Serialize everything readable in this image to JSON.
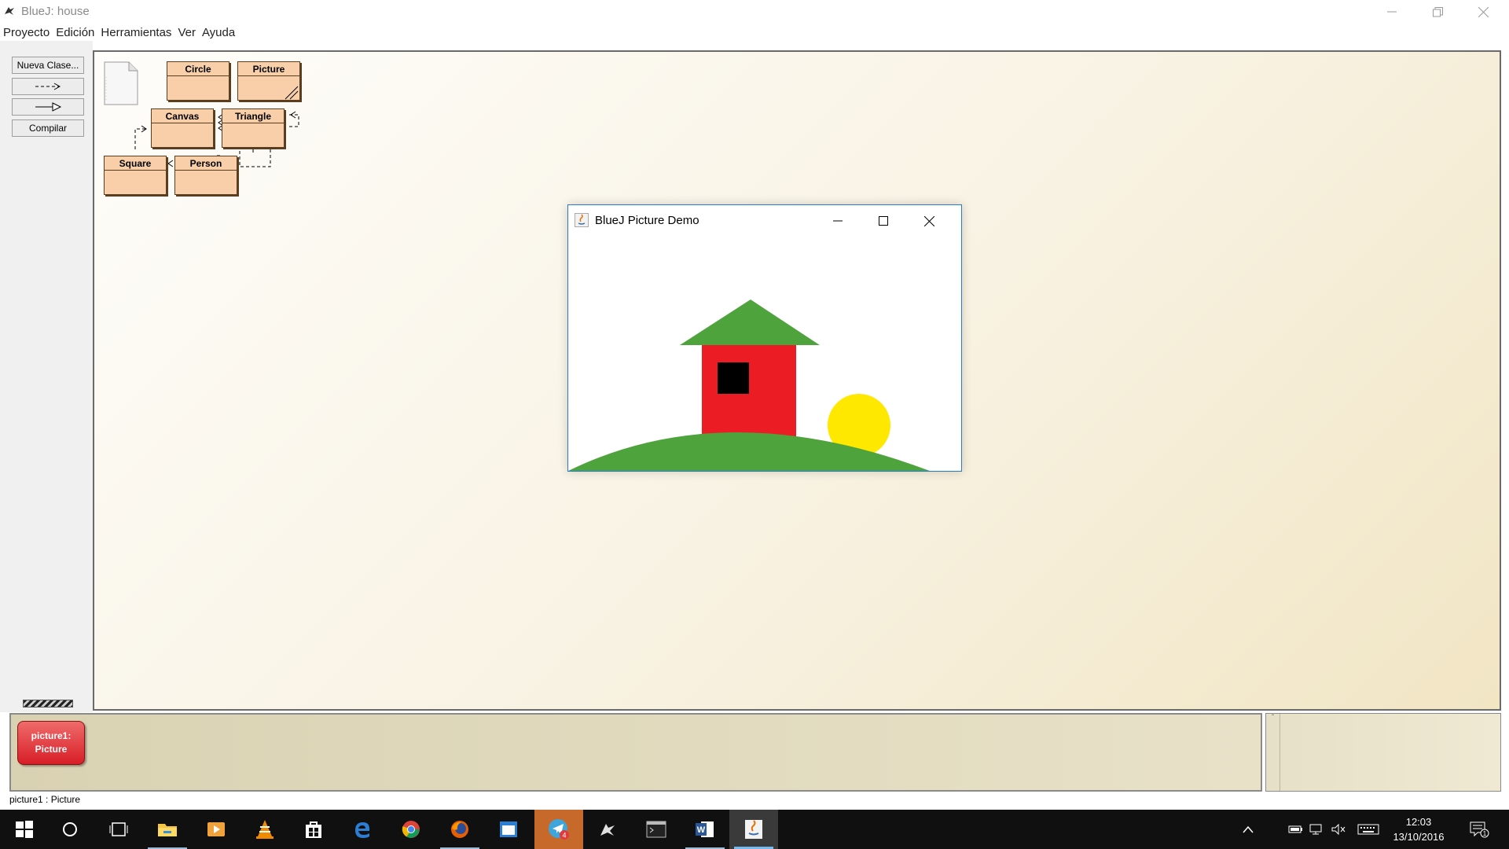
{
  "window": {
    "title": "BlueJ:  house"
  },
  "menu": [
    "Proyecto",
    "Edición",
    "Herramientas",
    "Ver",
    "Ayuda"
  ],
  "toolbar": {
    "new_class": "Nueva Clase...",
    "compile": "Compilar"
  },
  "diagram": {
    "classes": {
      "circle": "Circle",
      "picture": "Picture",
      "canvas": "Canvas",
      "triangle": "Triangle",
      "square": "Square",
      "person": "Person"
    }
  },
  "bench": {
    "object_line1": "picture1:",
    "object_line2": "Picture"
  },
  "status": "picture1 : Picture",
  "demo_window": {
    "title": "BlueJ Picture Demo",
    "colors": {
      "roof": "#4fa33c",
      "wall": "#ec1c24",
      "window": "#000000",
      "sun": "#ffe800",
      "ground": "#4fa33c"
    }
  },
  "taskbar": {
    "apps": [
      "start-icon",
      "search-icon",
      "task-view-icon",
      "file-explorer-icon",
      "media-player-icon",
      "vlc-icon",
      "store-icon",
      "edge-icon",
      "chrome-icon",
      "firefox-icon",
      "window-app-icon",
      "telegram-icon",
      "bluej-icon",
      "terminal-icon",
      "word-icon",
      "java-icon"
    ],
    "telegram_badge": "4",
    "clock_time": "12:03",
    "clock_date": "13/10/2016",
    "notification_count": "1"
  }
}
